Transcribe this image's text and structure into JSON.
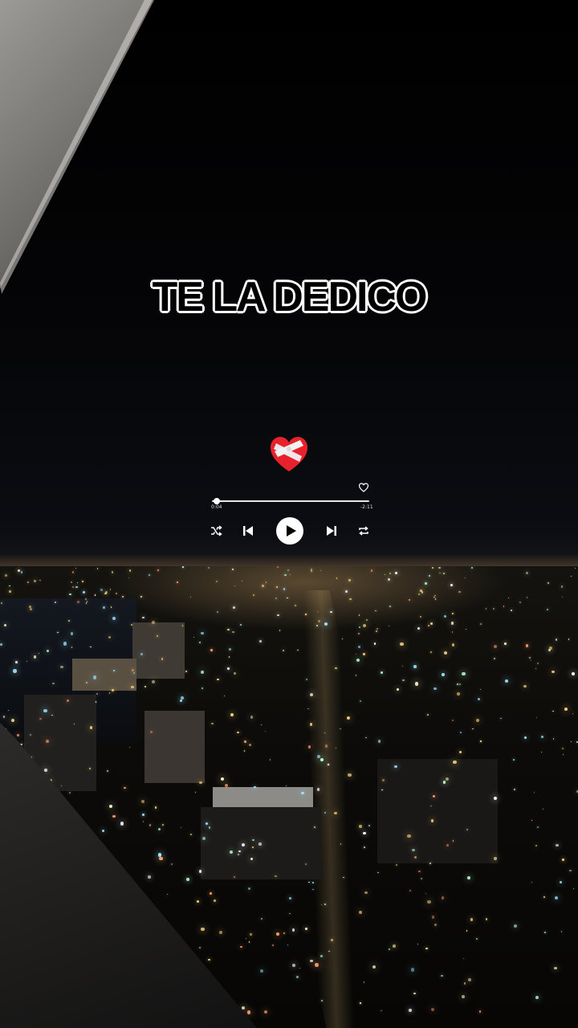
{
  "overlay": {
    "title": "TE LA DEDICO",
    "emoji": "mending-heart-icon"
  },
  "player": {
    "elapsed": "0:04",
    "remaining": "-2:11",
    "progress": 0.03,
    "controls": [
      "shuffle-icon",
      "previous-icon",
      "play-icon",
      "next-icon",
      "repeat-icon"
    ],
    "liked_icon": "heart-outline-icon"
  },
  "colors": {
    "accent": "#ffffff",
    "heart": "#e8222d",
    "bandage": "#f2f2f2"
  }
}
